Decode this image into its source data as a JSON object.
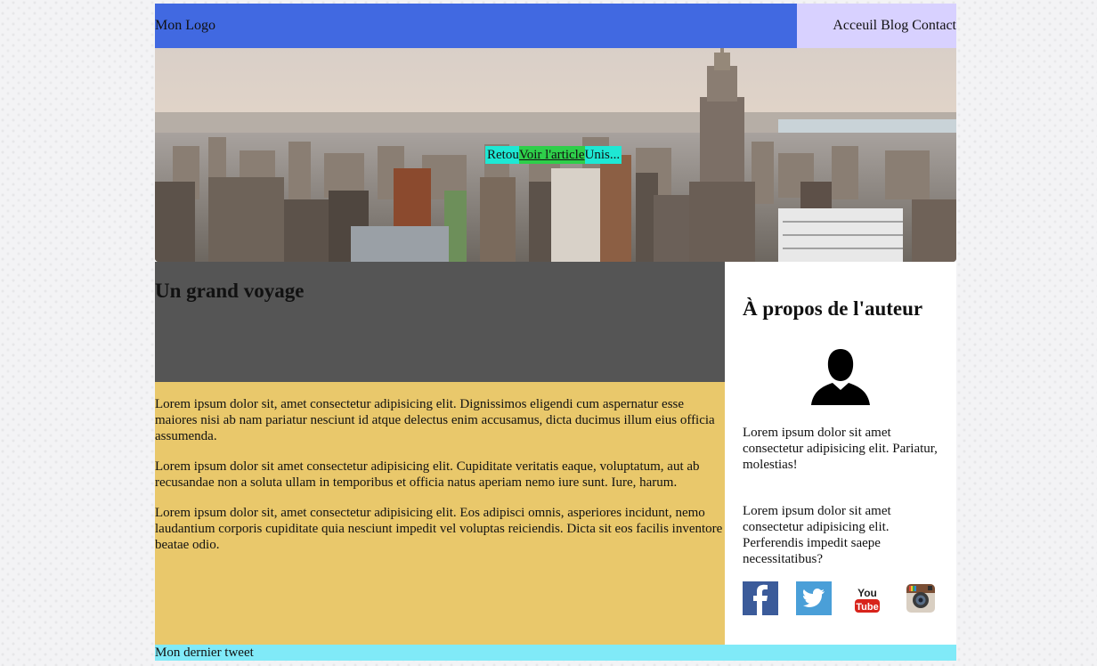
{
  "header": {
    "logo": "Mon Logo",
    "nav": [
      "Acceuil",
      "Blog",
      "Contact"
    ]
  },
  "hero": {
    "link_retour": "Retou",
    "link_voir": "Voir l'article",
    "link_unis": "Unis..."
  },
  "article": {
    "title": "Un grand voyage",
    "paragraphs": [
      "Lorem ipsum dolor sit, amet consectetur adipisicing elit. Dignissimos eligendi cum aspernatur esse maiores nisi ab nam pariatur nesciunt id atque delectus enim accusamus, dicta ducimus illum eius officia assumenda.",
      "Lorem ipsum dolor sit amet consectetur adipisicing elit. Cupiditate veritatis eaque, voluptatum, aut ab recusandae non a soluta ullam in temporibus et officia natus aperiam nemo iure sunt. Iure, harum.",
      "Lorem ipsum dolor sit, amet consectetur adipisicing elit. Eos adipisci omnis, asperiores incidunt, nemo laudantium corporis cupiditate quia nesciunt impedit vel voluptas reiciendis. Dicta sit eos facilis inventore beatae odio."
    ]
  },
  "aside": {
    "title": "À propos de l'auteur",
    "text1": "Lorem ipsum dolor sit amet consectetur adipisicing elit. Pariatur, molestias!",
    "text2": "Lorem ipsum dolor sit amet consectetur adipisicing elit. Perferendis impedit saepe necessitatibus?",
    "socials": [
      "facebook-icon",
      "twitter-icon",
      "youtube-icon",
      "instagram-icon"
    ],
    "youtube_label_top": "You",
    "youtube_label_bottom": "Tube"
  },
  "footer": {
    "text": "Mon dernier tweet"
  },
  "colors": {
    "header_bg": "#4169e1",
    "nav_bg": "#d8d1ff",
    "article_head_bg": "#555555",
    "article_body_bg": "#e9c86b",
    "footer_bg": "#80eaf8"
  }
}
